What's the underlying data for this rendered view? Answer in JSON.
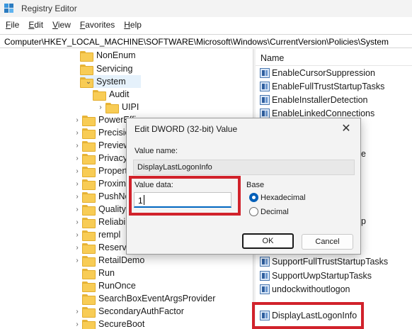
{
  "window": {
    "title": "Registry Editor"
  },
  "menu": {
    "file": "ile",
    "file_key": "F",
    "edit": "dit",
    "edit_key": "E",
    "view": "iew",
    "view_key": "V",
    "favorites": "avorites",
    "favorites_key": "F",
    "help": "elp",
    "help_key": "H"
  },
  "address": "Computer\\HKEY_LOCAL_MACHINE\\SOFTWARE\\Microsoft\\Windows\\CurrentVersion\\Policies\\System",
  "tree": {
    "items": [
      "NonEnum",
      "Servicing",
      "System",
      "Audit",
      "UIPI",
      "PowerEffi",
      "Precisio",
      "Preview",
      "Privacy",
      "Propert",
      "Proximi",
      "PushNo",
      "QualityC",
      "Reliabili",
      "rempl",
      "Reserve",
      "RetailDemo",
      "Run",
      "RunOnce",
      "SearchBoxEventArgsProvider",
      "SecondaryAuthFactor",
      "SecureBoot"
    ]
  },
  "list": {
    "header": "Name",
    "values": [
      "EnableCursorSuppression",
      "EnableFullTrustStartupTasks",
      "EnableInstallerDetection",
      "EnableLinkedConnections",
      "e",
      "p",
      "SupportFullTrustStartupTasks",
      "SupportUwpStartupTasks",
      "undockwithoutlogon",
      "DisplayLastLogonInfo"
    ]
  },
  "dialog": {
    "title": "Edit DWORD (32-bit) Value",
    "close_glyph": "✕",
    "value_name_label": "Value name:",
    "value_name": "DisplayLastLogonInfo",
    "value_data_label": "Value data:",
    "value_data": "1",
    "base_label": "Base",
    "hex_label": "Hexadecimal",
    "dec_label": "Decimal",
    "base_selected": "Hexadecimal",
    "ok_label": "OK",
    "cancel_label": "Cancel"
  },
  "icons": {
    "app": "registry-editor-icon",
    "folder": "folder-icon",
    "value": "reg-value-icon"
  },
  "colors": {
    "highlight": "#d1222b",
    "accent": "#0067c0",
    "folder": "#f8cc55"
  }
}
